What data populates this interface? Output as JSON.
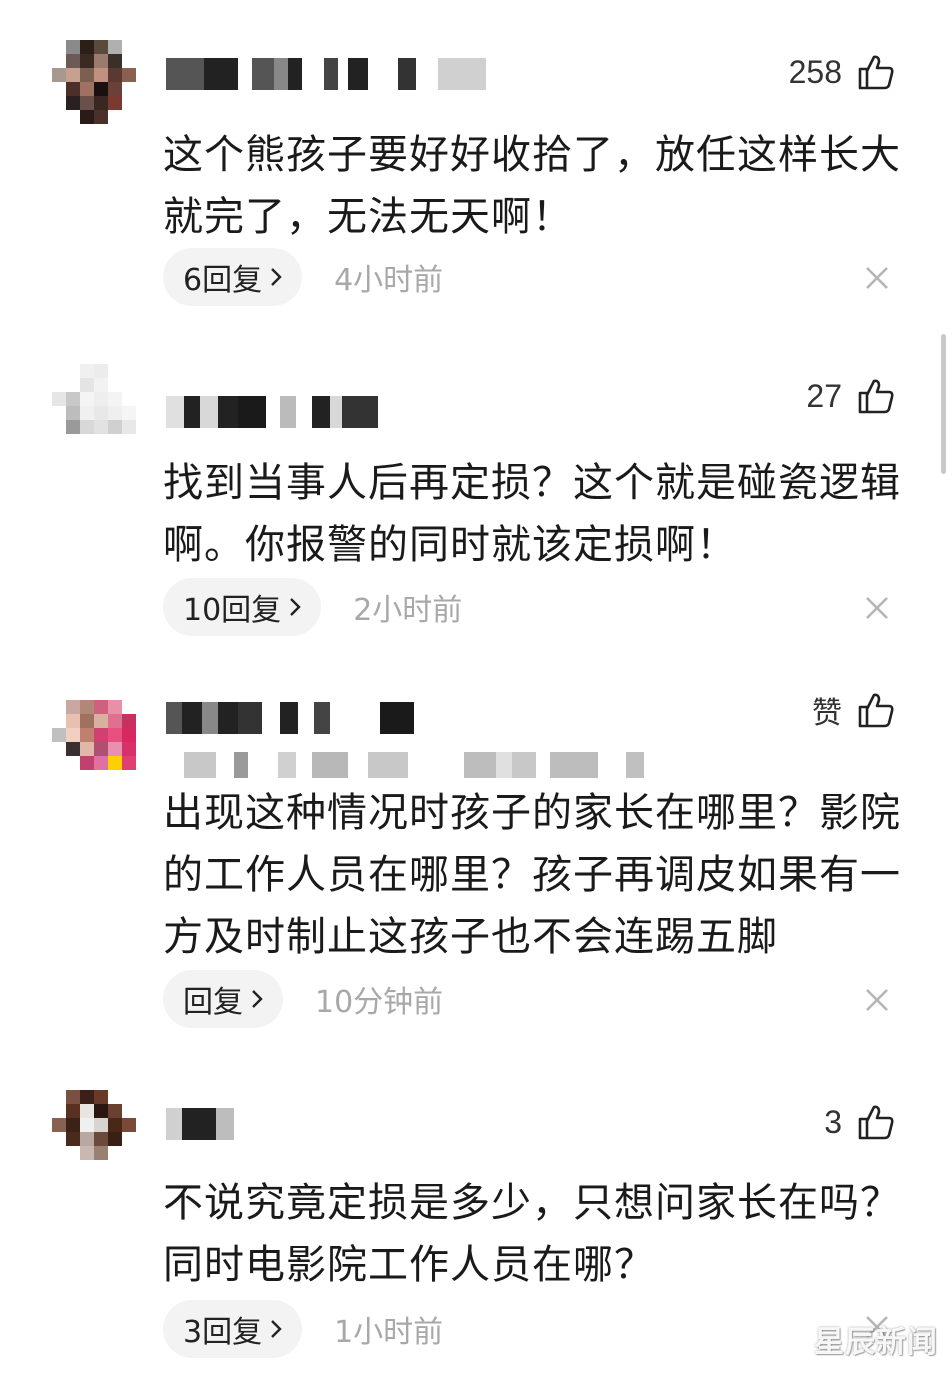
{
  "comments": [
    {
      "likes": "258",
      "text": "这个熊孩子要好好收拾了，放任这样长大就完了，无法无天啊！",
      "replies_label": "6回复",
      "time": "4小时前"
    },
    {
      "likes": "27",
      "text": "找到当事人后再定损？这个就是碰瓷逻辑啊。你报警的同时就该定损啊！",
      "replies_label": "10回复",
      "time": "2小时前"
    },
    {
      "likes": "赞",
      "text": "出现这种情况时孩子的家长在哪里？影院的工作人员在哪里？孩子再调皮如果有一方及时制止这孩子也不会连踢五脚",
      "replies_label": "回复",
      "time": "10分钟前"
    },
    {
      "likes": "3",
      "text": "不说究竟定损是多少，只想问家长在吗？同时电影院工作人员在哪？",
      "replies_label": "3回复",
      "time": "1小时前"
    }
  ],
  "icons": {
    "like": "thumbs-up-icon",
    "close": "close-icon",
    "reply_chevron": "chevron-right-icon"
  },
  "colors": {
    "pill_bg": "#f3f3f3",
    "meta_text": "#a8a8a8",
    "body_text": "#1a1a1a"
  },
  "watermark": "星辰新闻"
}
